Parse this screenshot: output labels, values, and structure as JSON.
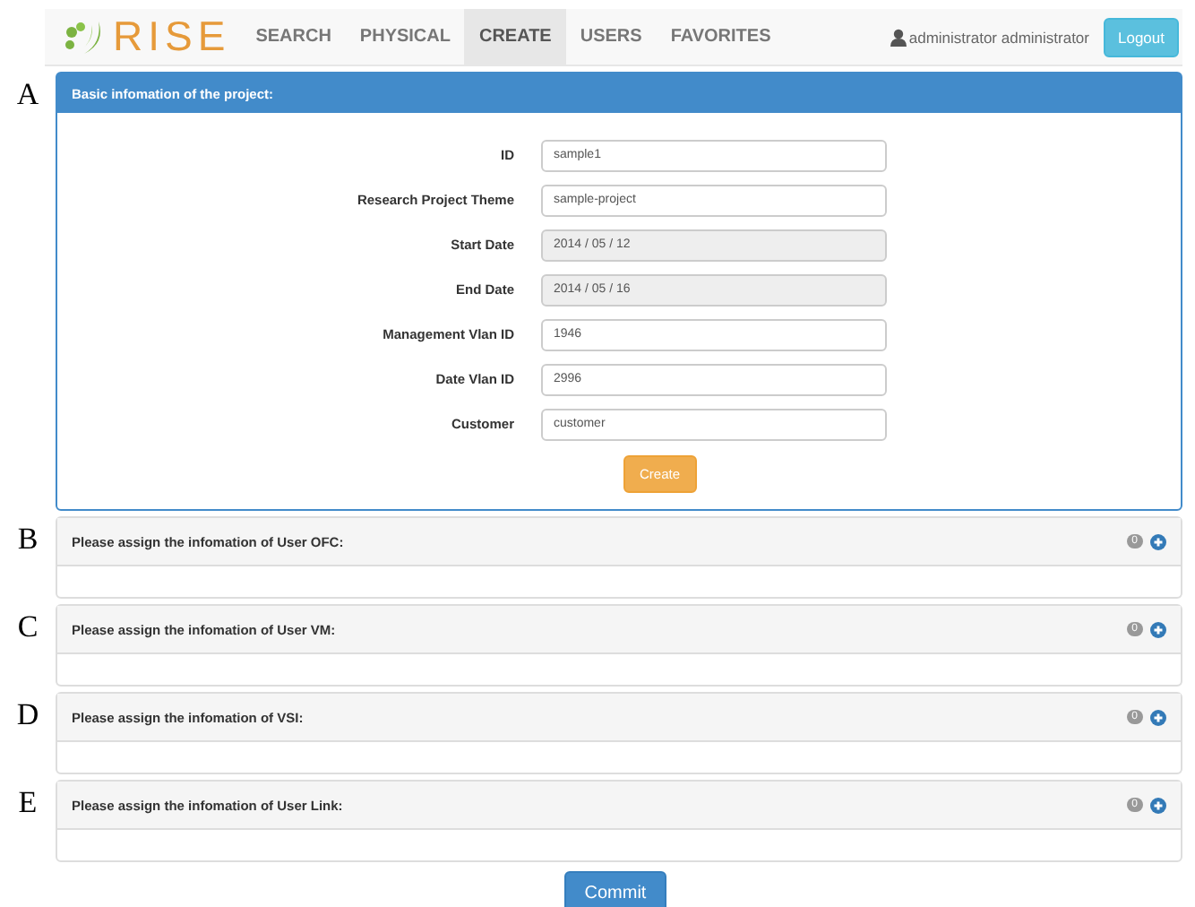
{
  "navbar": {
    "logo": "RISE",
    "items": [
      {
        "label": "SEARCH",
        "selected": false
      },
      {
        "label": "PHYSICAL",
        "selected": false
      },
      {
        "label": "CREATE",
        "selected": true
      },
      {
        "label": "USERS",
        "selected": false
      },
      {
        "label": "FAVORITES",
        "selected": false
      }
    ],
    "user": "administrator administrator",
    "logout": "Logout"
  },
  "main_panel": {
    "marker": "A",
    "title": "Basic infomation of the project:",
    "fields": [
      {
        "label": "ID",
        "value": "sample1",
        "disabled": false
      },
      {
        "label": "Research Project Theme",
        "value": "sample-project",
        "disabled": false
      },
      {
        "label": "Start Date",
        "value": "2014 / 05 / 12",
        "disabled": true
      },
      {
        "label": "End Date",
        "value": "2014 / 05 / 16",
        "disabled": true
      },
      {
        "label": "Management Vlan ID",
        "value": "1946",
        "disabled": false
      },
      {
        "label": "Date Vlan ID",
        "value": "2996",
        "disabled": false
      },
      {
        "label": "Customer",
        "value": "customer",
        "disabled": false
      }
    ],
    "button": "Create"
  },
  "panels": [
    {
      "marker": "B",
      "title": "Please assign the infomation of User OFC:",
      "count": "0"
    },
    {
      "marker": "C",
      "title": "Please assign the infomation of User VM:",
      "count": "0"
    },
    {
      "marker": "D",
      "title": "Please assign the infomation of VSI:",
      "count": "0"
    },
    {
      "marker": "E",
      "title": "Please assign the infomation of User Link:",
      "count": "0"
    }
  ],
  "commit": "Commit"
}
